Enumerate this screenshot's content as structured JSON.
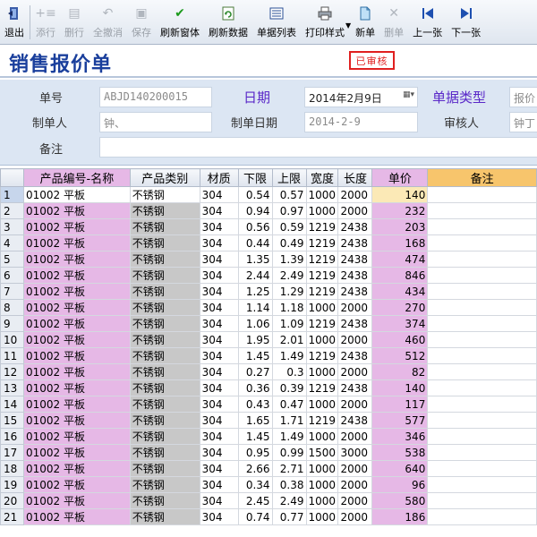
{
  "toolbar": {
    "items": [
      {
        "label": "退出",
        "icon": "exit-icon",
        "enabled": true
      },
      {
        "label": "添行",
        "icon": "add-row-icon",
        "enabled": false
      },
      {
        "label": "删行",
        "icon": "delete-row-icon",
        "enabled": false
      },
      {
        "label": "全撤消",
        "icon": "undo-icon",
        "enabled": false
      },
      {
        "label": "保存",
        "icon": "save-icon",
        "enabled": false
      },
      {
        "label": "刷新窗体",
        "icon": "check-icon",
        "enabled": true
      },
      {
        "label": "刷新数据",
        "icon": "refresh-icon",
        "enabled": true
      },
      {
        "label": "单据列表",
        "icon": "list-icon",
        "enabled": true
      },
      {
        "label": "打印样式",
        "icon": "printer-icon",
        "enabled": true
      },
      {
        "label": "新单",
        "icon": "new-doc-icon",
        "enabled": true
      },
      {
        "label": "删单",
        "icon": "delete-doc-icon",
        "enabled": false
      },
      {
        "label": "上一张",
        "icon": "prev-icon",
        "enabled": true
      },
      {
        "label": "下一张",
        "icon": "next-icon",
        "enabled": true
      }
    ]
  },
  "title": "销售报价单",
  "status_stamp": "已审核",
  "form": {
    "doc_no_label": "单号",
    "doc_no_value": "ABJD140200015",
    "date_label": "日期",
    "date_value": "2014年2月9日",
    "doc_type_label": "单据类型",
    "doc_type_value": "报价",
    "creator_label": "制单人",
    "creator_value": "钟、",
    "create_date_label": "制单日期",
    "create_date_value": "2014-2-9",
    "reviewer_label": "审核人",
    "reviewer_value": "钟丁",
    "remark_label": "备注",
    "remark_value": ""
  },
  "grid": {
    "columns": [
      "",
      "产品编号-名称",
      "产品类别",
      "材质",
      "下限",
      "上限",
      "宽度",
      "长度",
      "单价",
      "备注"
    ],
    "rows": [
      [
        "1",
        "01002 平板",
        "不锈钢",
        "304",
        "0.54",
        "0.57",
        "1000",
        "2000",
        "140",
        ""
      ],
      [
        "2",
        "01002 平板",
        "不锈钢",
        "304",
        "0.94",
        "0.97",
        "1000",
        "2000",
        "232",
        ""
      ],
      [
        "3",
        "01002 平板",
        "不锈钢",
        "304",
        "0.56",
        "0.59",
        "1219",
        "2438",
        "203",
        ""
      ],
      [
        "4",
        "01002 平板",
        "不锈钢",
        "304",
        "0.44",
        "0.49",
        "1219",
        "2438",
        "168",
        ""
      ],
      [
        "5",
        "01002 平板",
        "不锈钢",
        "304",
        "1.35",
        "1.39",
        "1219",
        "2438",
        "474",
        ""
      ],
      [
        "6",
        "01002 平板",
        "不锈钢",
        "304",
        "2.44",
        "2.49",
        "1219",
        "2438",
        "846",
        ""
      ],
      [
        "7",
        "01002 平板",
        "不锈钢",
        "304",
        "1.25",
        "1.29",
        "1219",
        "2438",
        "434",
        ""
      ],
      [
        "8",
        "01002 平板",
        "不锈钢",
        "304",
        "1.14",
        "1.18",
        "1000",
        "2000",
        "270",
        ""
      ],
      [
        "9",
        "01002 平板",
        "不锈钢",
        "304",
        "1.06",
        "1.09",
        "1219",
        "2438",
        "374",
        ""
      ],
      [
        "10",
        "01002 平板",
        "不锈钢",
        "304",
        "1.95",
        "2.01",
        "1000",
        "2000",
        "460",
        ""
      ],
      [
        "11",
        "01002 平板",
        "不锈钢",
        "304",
        "1.45",
        "1.49",
        "1219",
        "2438",
        "512",
        ""
      ],
      [
        "12",
        "01002 平板",
        "不锈钢",
        "304",
        "0.27",
        "0.3",
        "1000",
        "2000",
        "82",
        ""
      ],
      [
        "13",
        "01002 平板",
        "不锈钢",
        "304",
        "0.36",
        "0.39",
        "1219",
        "2438",
        "140",
        ""
      ],
      [
        "14",
        "01002 平板",
        "不锈钢",
        "304",
        "0.43",
        "0.47",
        "1000",
        "2000",
        "117",
        ""
      ],
      [
        "15",
        "01002 平板",
        "不锈钢",
        "304",
        "1.65",
        "1.71",
        "1219",
        "2438",
        "577",
        ""
      ],
      [
        "16",
        "01002 平板",
        "不锈钢",
        "304",
        "1.45",
        "1.49",
        "1000",
        "2000",
        "346",
        ""
      ],
      [
        "17",
        "01002 平板",
        "不锈钢",
        "304",
        "0.95",
        "0.99",
        "1500",
        "3000",
        "538",
        ""
      ],
      [
        "18",
        "01002 平板",
        "不锈钢",
        "304",
        "2.66",
        "2.71",
        "1000",
        "2000",
        "640",
        ""
      ],
      [
        "19",
        "01002 平板",
        "不锈钢",
        "304",
        "0.34",
        "0.38",
        "1000",
        "2000",
        "96",
        ""
      ],
      [
        "20",
        "01002 平板",
        "不锈钢",
        "304",
        "2.45",
        "2.49",
        "1000",
        "2000",
        "580",
        ""
      ],
      [
        "21",
        "01002 平板",
        "不锈钢",
        "304",
        "0.74",
        "0.77",
        "1000",
        "2000",
        "186",
        ""
      ]
    ]
  }
}
